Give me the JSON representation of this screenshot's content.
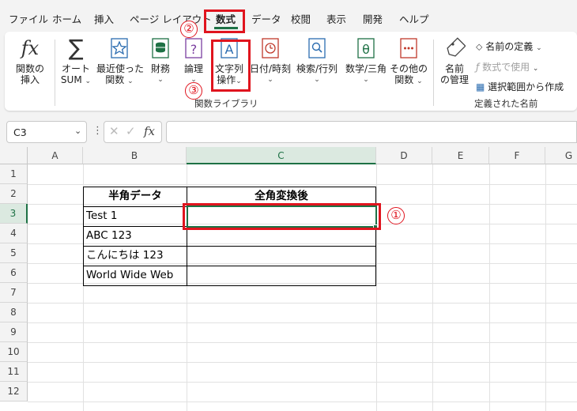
{
  "tabs": [
    "ファイル",
    "ホーム",
    "挿入",
    "ページ レイアウト",
    "数式",
    "データ",
    "校閲",
    "表示",
    "開発",
    "ヘルプ"
  ],
  "ribbon": {
    "insert_function": [
      "関数の",
      "挿入"
    ],
    "autosum": [
      "オート",
      "SUM"
    ],
    "recent": [
      "最近使った",
      "関数"
    ],
    "financial": "財務",
    "logical": "論理",
    "text": [
      "文字列",
      "操作"
    ],
    "datetime": "日付/時刻",
    "lookup": "検索/行列",
    "math": "数学/三角",
    "more": [
      "その他の",
      "関数"
    ],
    "name_manager": [
      "名前",
      "の管理"
    ],
    "define_name": "名前の定義",
    "use_in_formula": "数式で使用",
    "create_from_selection": "選択範囲から作成",
    "group_function_library": "関数ライブラリ",
    "group_defined_names": "定義された名前"
  },
  "formula_bar": {
    "name_box": "C3",
    "fx": "fx",
    "value": ""
  },
  "columns": [
    "A",
    "B",
    "C",
    "D",
    "E",
    "F",
    "G"
  ],
  "rows": [
    "1",
    "2",
    "3",
    "4",
    "5",
    "6",
    "7",
    "8",
    "9",
    "10",
    "11",
    "12"
  ],
  "table": {
    "header_b": "半角データ",
    "header_c": "全角変換後",
    "b_values": [
      "Test 1",
      "ABC 123",
      "こんにちは 123",
      "World Wide Web"
    ],
    "c_values": [
      "",
      "",
      "",
      ""
    ]
  },
  "annotations": {
    "marker_1": "①",
    "marker_2": "②",
    "marker_3": "③"
  },
  "colors": {
    "accent": "#1e7145",
    "annotation": "#e0141e"
  }
}
